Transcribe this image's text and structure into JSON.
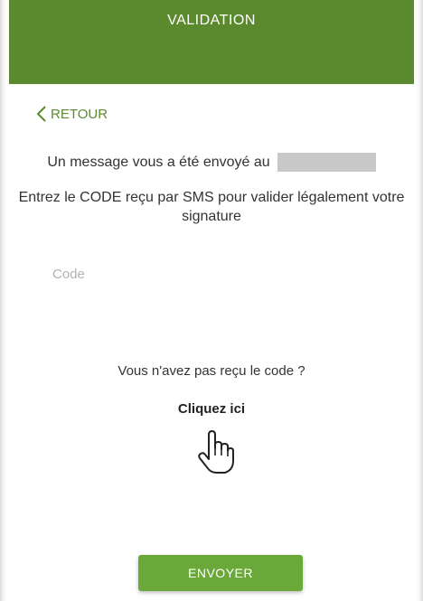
{
  "header": {
    "title": "VALIDATION"
  },
  "navigation": {
    "back_label": "RETOUR",
    "back_icon": "chevron-left-icon"
  },
  "message": {
    "sent_text": "Un message vous a été envoyé au",
    "phone_number_redacted": true
  },
  "instruction": {
    "text": "Entrez le CODE reçu par SMS pour valider légalement votre signature"
  },
  "code_field": {
    "placeholder": "Code",
    "value": ""
  },
  "resend": {
    "question": "Vous n'avez pas reçu le code ?",
    "link_label": "Cliquez ici",
    "cursor_icon": "hand-pointer-icon"
  },
  "actions": {
    "submit_label": "ENVOYER"
  },
  "colors": {
    "brand_green": "#5b8a2e",
    "button_green": "#6aa83a",
    "redaction_gray": "#c8c8c8"
  }
}
